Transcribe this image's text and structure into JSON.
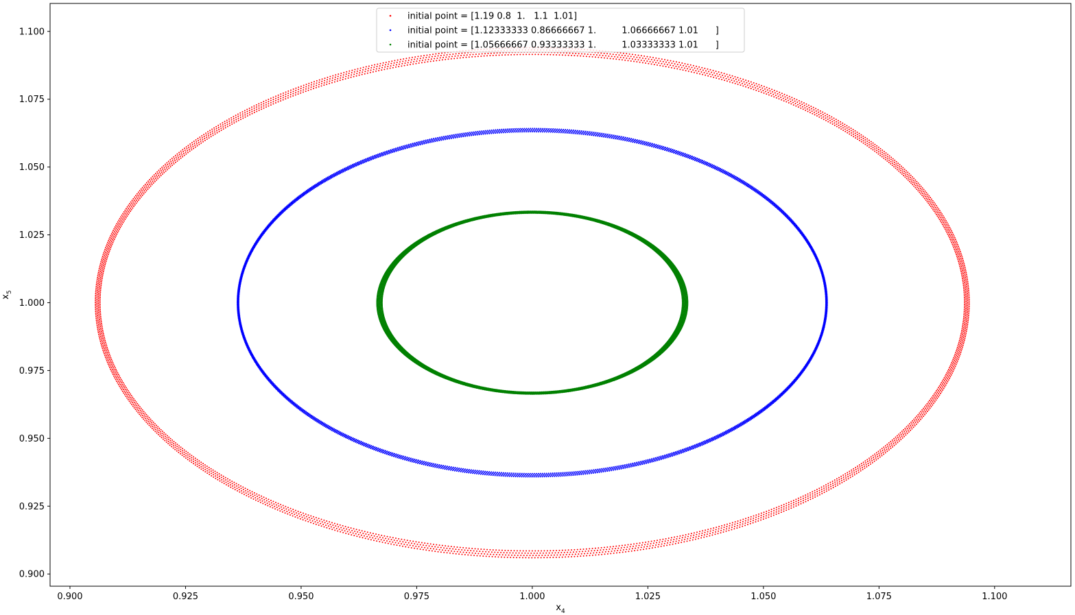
{
  "chart_data": {
    "type": "scatter",
    "title": "",
    "xlabel": "x",
    "xlabel_sub": "4",
    "ylabel": "x",
    "ylabel_sub": "5",
    "xlim": [
      0.8957,
      1.1165
    ],
    "ylim": [
      0.8955,
      1.1103
    ],
    "xticks": [
      "0.900",
      "0.925",
      "0.950",
      "0.975",
      "1.000",
      "1.025",
      "1.050",
      "1.075",
      "1.100"
    ],
    "yticks": [
      "0.900",
      "0.925",
      "0.950",
      "0.975",
      "1.000",
      "1.025",
      "1.050",
      "1.075",
      "1.100"
    ],
    "grid": false,
    "legend_position": "top-center",
    "series": [
      {
        "name": "initial point = [1.19 0.8  1.   1.1  1.01]",
        "color": "#ff0000",
        "center": [
          1.0,
          1.0
        ],
        "radius_x": [
          0.0935,
          0.0945
        ],
        "radius_y": [
          0.0915,
          0.094
        ],
        "rings": 4
      },
      {
        "name": "initial point = [1.12333333 0.86666667 1.         1.06666667 1.01      ]",
        "color": "#0000ff",
        "center": [
          1.0,
          1.0
        ],
        "radius_x": [
          0.0635,
          0.0638
        ],
        "radius_y": [
          0.063,
          0.0642
        ],
        "rings": 4
      },
      {
        "name": "initial point = [1.05666667 0.93333333 1.         1.03333333 1.01      ]",
        "color": "#008000",
        "center": [
          1.0,
          1.0
        ],
        "radius_x": [
          0.0325,
          0.0336
        ],
        "radius_y": [
          0.033,
          0.0337
        ],
        "rings": 5
      }
    ]
  }
}
